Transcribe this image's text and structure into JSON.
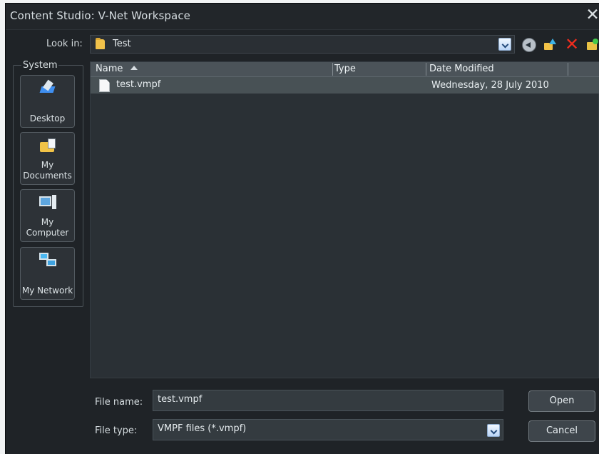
{
  "window": {
    "title": "Content Studio: V-Net Workspace",
    "close_symbol": "✕"
  },
  "look_in": {
    "label": "Look in:",
    "value": "Test"
  },
  "places": {
    "group_label": "System",
    "items": [
      {
        "label": "Desktop",
        "icon": "desktop-icon"
      },
      {
        "label": "My Documents",
        "icon": "documents-icon"
      },
      {
        "label": "My Computer",
        "icon": "computer-icon"
      },
      {
        "label": "My Network",
        "icon": "network-icon"
      }
    ]
  },
  "file_list": {
    "columns": [
      "Name",
      "Type",
      "Date Modified"
    ],
    "rows": [
      {
        "name": "test.vmpf",
        "type": "",
        "date": "Wednesday, 28 July 2010"
      }
    ]
  },
  "form": {
    "file_name_label": "File name:",
    "file_name_value": "test.vmpf",
    "file_type_label": "File type:",
    "file_type_value": "VMPF files (*.vmpf)"
  },
  "buttons": {
    "open": "Open",
    "cancel": "Cancel"
  },
  "colors": {
    "window_background": "#1f2327",
    "selected_row": "#485155",
    "warning_delete": "#ef2c1e"
  }
}
